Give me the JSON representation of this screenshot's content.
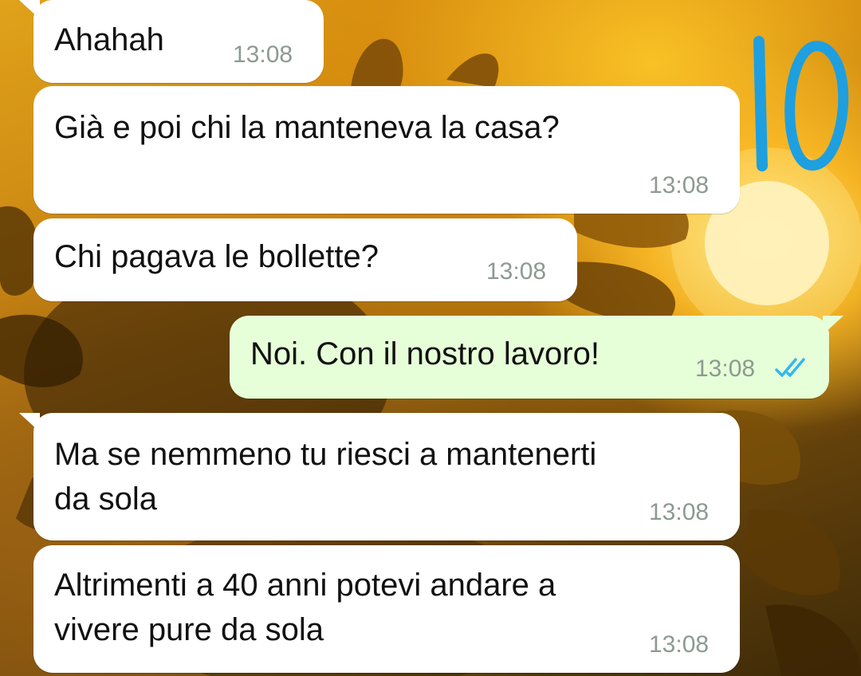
{
  "annotation": {
    "label": "10",
    "color": "#1e9fe0"
  },
  "messages": [
    {
      "direction": "in",
      "text": "Ahahah",
      "time": "13:08"
    },
    {
      "direction": "in",
      "text": "Già e poi chi la manteneva la casa?",
      "time": "13:08"
    },
    {
      "direction": "in",
      "text": "Chi pagava le bollette?",
      "time": "13:08"
    },
    {
      "direction": "out",
      "text": "Noi. Con il nostro lavoro!",
      "time": "13:08",
      "status": "read-double-check-icon"
    },
    {
      "direction": "in",
      "text": "Ma se nemmeno tu riesci a mantenerti\nda sola",
      "time": "13:08"
    },
    {
      "direction": "in",
      "text": "Altrimenti a 40 anni potevi andare a\nvivere pure da sola",
      "time": "13:08"
    }
  ],
  "colors": {
    "incoming_bubble": "#ffffff",
    "outgoing_bubble": "#e6ffd8",
    "read_ticks": "#34b7f1",
    "timestamp": "#8d9a92"
  }
}
